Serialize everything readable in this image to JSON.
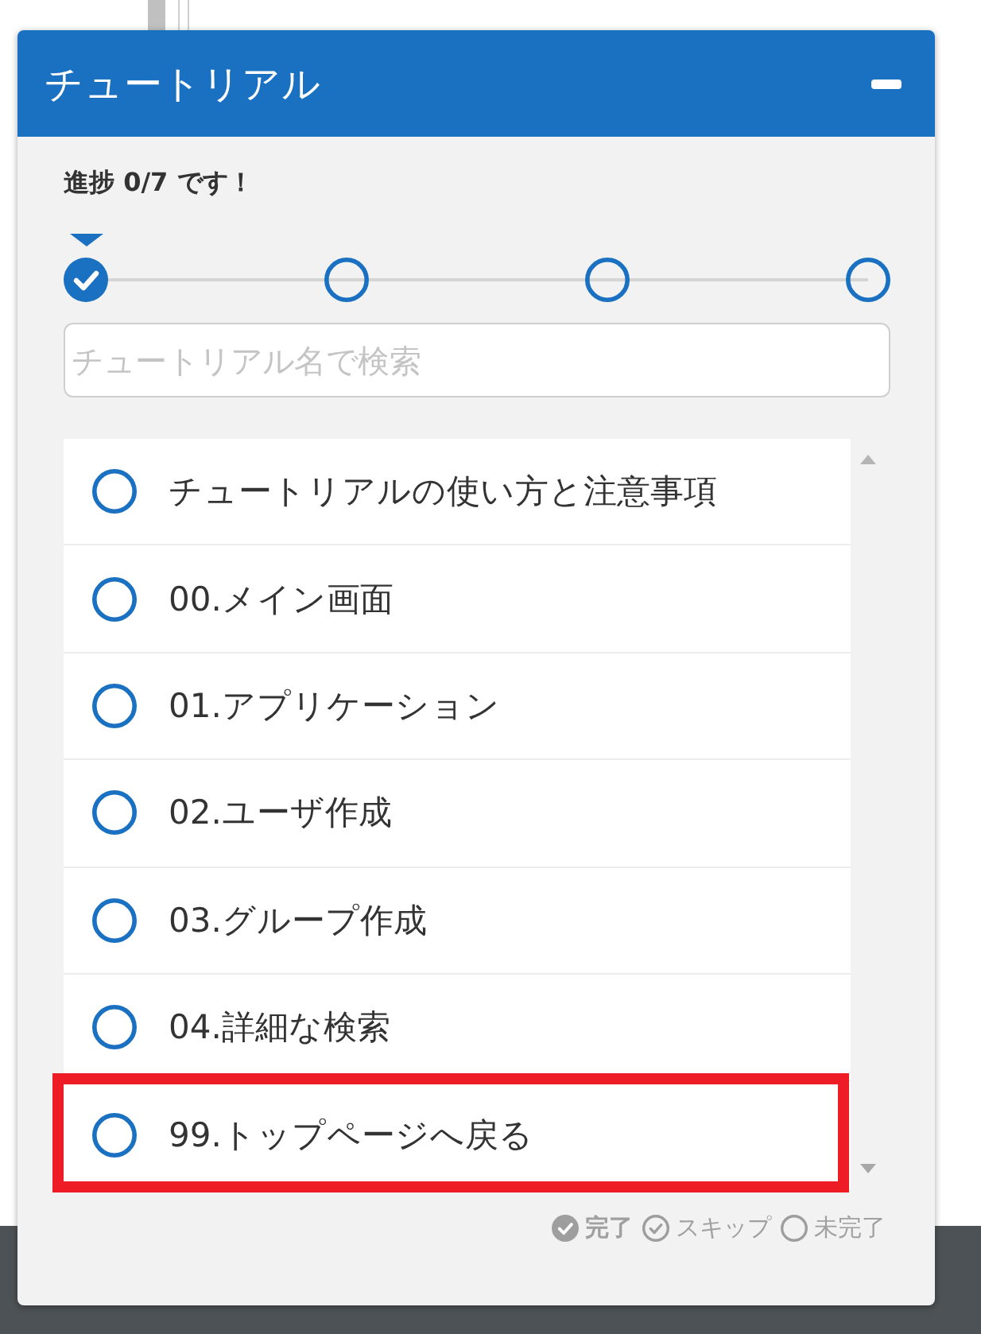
{
  "panel": {
    "title": "チュートリアル"
  },
  "progress": {
    "text": "進捗 0/7 です！",
    "steps": [
      {
        "checked": true,
        "selected": true
      },
      {
        "checked": false,
        "selected": false
      },
      {
        "checked": false,
        "selected": false
      },
      {
        "checked": false,
        "selected": false
      }
    ]
  },
  "search": {
    "placeholder": "チュートリアル名で検索"
  },
  "tutorials": [
    {
      "label": "チュートリアルの使い方と注意事項",
      "checked": false,
      "highlighted": false
    },
    {
      "label": "00.メイン画面",
      "checked": false,
      "highlighted": false
    },
    {
      "label": "01.アプリケーション",
      "checked": false,
      "highlighted": false
    },
    {
      "label": "02.ユーザ作成",
      "checked": false,
      "highlighted": false
    },
    {
      "label": "03.グループ作成",
      "checked": false,
      "highlighted": false
    },
    {
      "label": "04.詳細な検索",
      "checked": false,
      "highlighted": false
    },
    {
      "label": "99.トップページへ戻る",
      "checked": false,
      "highlighted": true
    }
  ],
  "legend": [
    {
      "kind": "done",
      "label": "完了",
      "selected": true
    },
    {
      "kind": "skipped",
      "label": "スキップ",
      "selected": false
    },
    {
      "kind": "incomplete",
      "label": "未完了",
      "selected": false
    }
  ]
}
